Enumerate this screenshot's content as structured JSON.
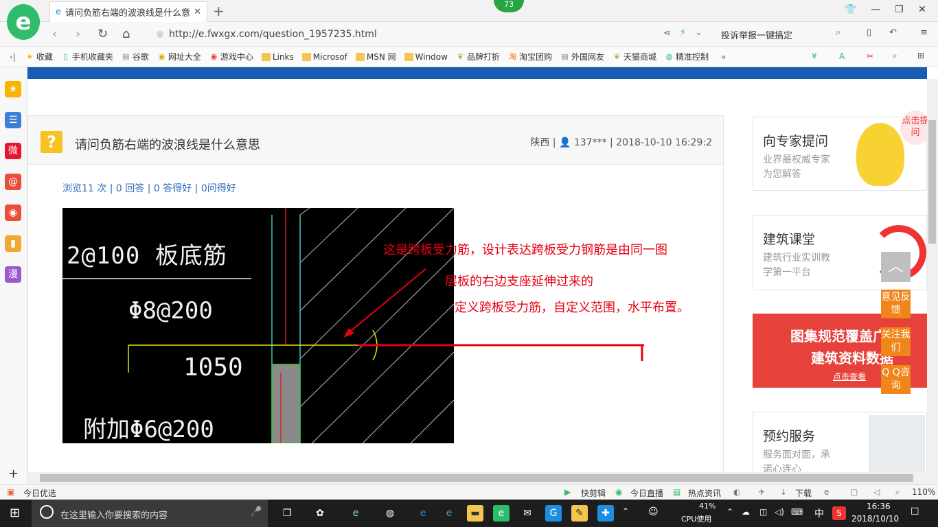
{
  "browser": {
    "logo_letter": "e",
    "tab_title": "请问负筋右端的波浪线是什么意思",
    "tab_close": "✕",
    "new_tab": "+",
    "notification_count": "73",
    "url": "http://e.fwxgx.com/question_1957235.html",
    "report_text": "投诉举报一键搞定",
    "window_controls": {
      "minimize": "—",
      "maximize": "❐",
      "close": "✕"
    }
  },
  "bookmarks": [
    {
      "label": "收藏",
      "icon": "star-icon"
    },
    {
      "label": "手机收藏夹",
      "icon": "phone-icon"
    },
    {
      "label": "谷歌",
      "icon": "page-icon"
    },
    {
      "label": "网址大全",
      "icon": "globe-icon"
    },
    {
      "label": "游戏中心",
      "icon": "game-icon"
    },
    {
      "label": "Links",
      "icon": "folder-icon"
    },
    {
      "label": "Microsof",
      "icon": "folder-icon"
    },
    {
      "label": "MSN 网",
      "icon": "folder-icon"
    },
    {
      "label": "Window",
      "icon": "folder-icon"
    },
    {
      "label": "品牌打折",
      "icon": "leaf-icon"
    },
    {
      "label": "淘宝团购",
      "icon": "taobao-icon"
    },
    {
      "label": "外国网友",
      "icon": "page-icon"
    },
    {
      "label": "天猫商城",
      "icon": "leaf-icon"
    },
    {
      "label": "精准控制",
      "icon": "wechat-icon"
    }
  ],
  "left_sidebar": [
    {
      "icon": "star-icon",
      "text": "★",
      "color": "#f7b500"
    },
    {
      "icon": "list-icon",
      "text": "☰",
      "color": "#3d7fd6"
    },
    {
      "icon": "weibo-icon",
      "text": "微",
      "color": "#e6162d"
    },
    {
      "icon": "at-icon",
      "text": "@",
      "color": "#e94e3c"
    },
    {
      "icon": "gamepad-icon",
      "text": "◉",
      "color": "#e94e3c"
    },
    {
      "icon": "book-icon",
      "text": "▮",
      "color": "#f0a830"
    },
    {
      "icon": "comic-icon",
      "text": "漫",
      "color": "#9b59d0"
    }
  ],
  "question": {
    "title": "请问负筋右端的波浪线是什么意思",
    "location": "陕西",
    "user": "137***",
    "datetime": "2018-10-10 16:29:2",
    "stats": "浏览11 次 | 0 回答 | 0 答得好 | 0问得好",
    "icon_text": "?"
  },
  "drawing": {
    "label1": "2@100 板底筋",
    "label2": "Φ8@200",
    "label3": "1050",
    "label4": "附加Φ6@200"
  },
  "annotations": {
    "line1": "这是跨板受力筋，设计表达跨板受力钢筋是由同一图",
    "line2": "层板的右边支座延伸过来的",
    "line3": "定义跨板受力筋，自定义范围，水平布置。"
  },
  "sidebar": {
    "expert": {
      "title": "向专家提问",
      "sub1": "业界最权威专家",
      "sub2": "为您解答",
      "badge": "点击提问"
    },
    "course": {
      "title": "建筑课堂",
      "sub1": "建筑行业实训教",
      "sub2": "学第一平台"
    },
    "banner": {
      "line1": "图集规范覆盖广",
      "line2": "建筑资料数据",
      "link": "点击查看"
    },
    "service": {
      "title": "预约服务",
      "sub1": "服务面对面，承",
      "sub2": "诺心连心"
    }
  },
  "floating": {
    "feedback": "意见反馈",
    "follow": "关注我们",
    "qq": "Q Q咨询"
  },
  "statusbar": {
    "left": "今日优选",
    "items": [
      "快剪辑",
      "今日直播",
      "热点资讯",
      "下载"
    ],
    "zoom": "110%"
  },
  "taskbar": {
    "search_placeholder": "在这里输入你要搜索的内容",
    "cpu_percent": "41%",
    "cpu_label": "CPU使用",
    "ime": "中",
    "time": "16:36",
    "date": "2018/10/10"
  },
  "colors": {
    "accent_blue": "#1a5cb3",
    "annotation_red": "#e60012",
    "float_orange": "#f08519",
    "logo_green": "#2ebd6b"
  }
}
